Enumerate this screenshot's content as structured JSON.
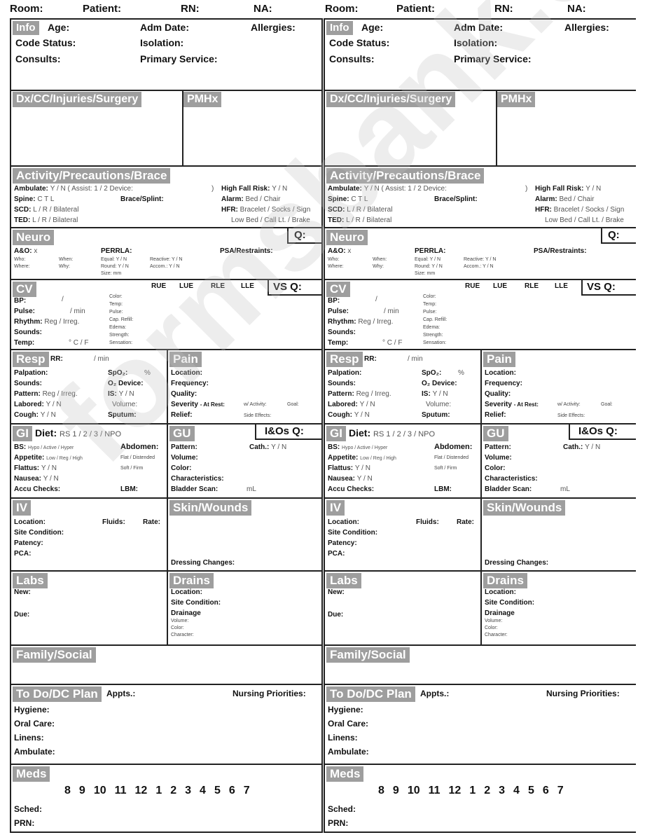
{
  "header_fields": [
    "Room:",
    "Patient:",
    "RN:",
    "NA:"
  ],
  "info": {
    "title": "Info",
    "age": "Age:",
    "adm_date": "Adm Date:",
    "allergies": "Allergies:",
    "code_status": "Code Status:",
    "isolation": "Isolation:",
    "consults": "Consults:",
    "primary_service": "Primary Service:"
  },
  "dx": {
    "title": "Dx/CC/Injuries/Surgery"
  },
  "pmhx": {
    "title": "PMHx"
  },
  "activity": {
    "title": "Activity/Precautions/Brace",
    "ambulate_label": "Ambulate:",
    "ambulate_opts": "Y / N",
    "assist": "( Assist: 1 / 2  Device:",
    "close_paren": ")",
    "high_fall_label": "High Fall Risk:",
    "high_fall_opts": "Y / N",
    "spine_label": "Spine:",
    "spine_opts": "C  T  L",
    "brace": "Brace/Splint:",
    "alarm_label": "Alarm:",
    "alarm_opts": "Bed / Chair",
    "scd_label": "SCD:",
    "scd_opts": "L / R / Bilateral",
    "hfr_label": "HFR:",
    "hfr_opts": "Bracelet / Socks / Sign",
    "ted_label": "TED:",
    "ted_opts": "L / R / Bilateral",
    "hfr_opts2": "Low Bed / Call Lt. / Brake"
  },
  "neuro": {
    "title": "Neuro",
    "q": "Q:",
    "ao_label": "A&O:",
    "ao_val": "x",
    "who": "Who:",
    "when": "When:",
    "where": "Where:",
    "why": "Why:",
    "perrla": "PERRLA:",
    "equal": "Equal: Y / N",
    "reactive": "Reactive: Y / N",
    "round": "Round: Y / N",
    "accom": "Accom.: Y / N",
    "size": "Size:    mm",
    "psa": "PSA/Restraints:"
  },
  "cv": {
    "title": "CV",
    "limbs": [
      "RUE",
      "LUE",
      "RLE",
      "LLE"
    ],
    "vs_q": "VS Q:",
    "bp": "BP:",
    "bp_slash": "/",
    "pulse": "Pulse:",
    "pulse_unit": "/ min",
    "rhythm": "Rhythm:",
    "rhythm_opts": "Reg / Irreg.",
    "sounds": "Sounds:",
    "temp": "Temp:",
    "temp_unit": "° C / F",
    "assess": [
      "Color:",
      "Temp:",
      "Pulse:",
      "Cap. Refill:",
      "Edema:",
      "Strength:",
      "Sensation:"
    ]
  },
  "resp": {
    "title": "Resp",
    "rr": "RR:",
    "rr_unit": "/ min",
    "palpation": "Palpation:",
    "spo2": "SpO₂:",
    "spo2_unit": "%",
    "sounds": "Sounds:",
    "o2_device": "O₂ Device:",
    "pattern": "Pattern:",
    "pattern_opts": "Reg / Irreg.",
    "is": "IS:",
    "is_opts": "Y / N",
    "labored": "Labored:",
    "labored_opts": "Y / N",
    "volume": "Volume:",
    "cough": "Cough:",
    "cough_opts": "Y / N",
    "sputum": "Sputum:"
  },
  "pain": {
    "title": "Pain",
    "location": "Location:",
    "frequency": "Frequency:",
    "quality": "Quality:",
    "severity": "Severity",
    "at_rest": "- At Rest:",
    "w_activity": "w/ Activity:",
    "goal": "Goal:",
    "relief": "Relief:",
    "side_effects": "Side Effects:"
  },
  "gi": {
    "title": "GI",
    "diet_label": "Diet:",
    "diet_opts": "RS 1 / 2 / 3 / NPO",
    "bs": "BS:",
    "bs_opts": "Hypo / Active / Hyper",
    "abdomen": "Abdomen:",
    "appetite": "Appetite:",
    "appetite_opts": "Low / Reg / High",
    "abd_opts1": "Flat / Distended",
    "flattus": "Flattus:",
    "flattus_opts": "Y / N",
    "abd_opts2": "Soft / Firm",
    "nausea": "Nausea:",
    "nausea_opts": "Y / N",
    "accu": "Accu Checks:",
    "lbm": "LBM:"
  },
  "gu": {
    "title": "GU",
    "ios_q": "I&Os Q:",
    "pattern": "Pattern:",
    "cath": "Cath.:",
    "cath_opts": "Y / N",
    "volume": "Volume:",
    "color": "Color:",
    "characteristics": "Characteristics:",
    "bladder": "Bladder Scan:",
    "bladder_unit": "mL"
  },
  "iv": {
    "title": "IV",
    "location": "Location:",
    "fluids": "Fluids:",
    "rate": "Rate:",
    "site": "Site Condition:",
    "patency": "Patency:",
    "pca": "PCA:"
  },
  "skin": {
    "title": "Skin/Wounds",
    "dressing": "Dressing Changes:"
  },
  "labs": {
    "title": "Labs",
    "new": "New:",
    "due": "Due:"
  },
  "drains": {
    "title": "Drains",
    "location": "Location:",
    "site": "Site Condition:",
    "drainage": "Drainage",
    "volume": "Volume:",
    "color": "Color:",
    "character": "Character:"
  },
  "family": {
    "title": "Family/Social"
  },
  "todo": {
    "title": "To Do/DC Plan",
    "appts": "Appts.:",
    "priorities": "Nursing Priorities:",
    "items": [
      "Hygiene:",
      "Oral Care:",
      "Linens:",
      "Ambulate:"
    ]
  },
  "meds": {
    "title": "Meds",
    "hours": [
      "8",
      "9",
      "10",
      "11",
      "12",
      "1",
      "2",
      "3",
      "4",
      "5",
      "6",
      "7"
    ],
    "sched": "Sched:",
    "prn": "PRN:"
  },
  "watermark": "formsbank.com"
}
